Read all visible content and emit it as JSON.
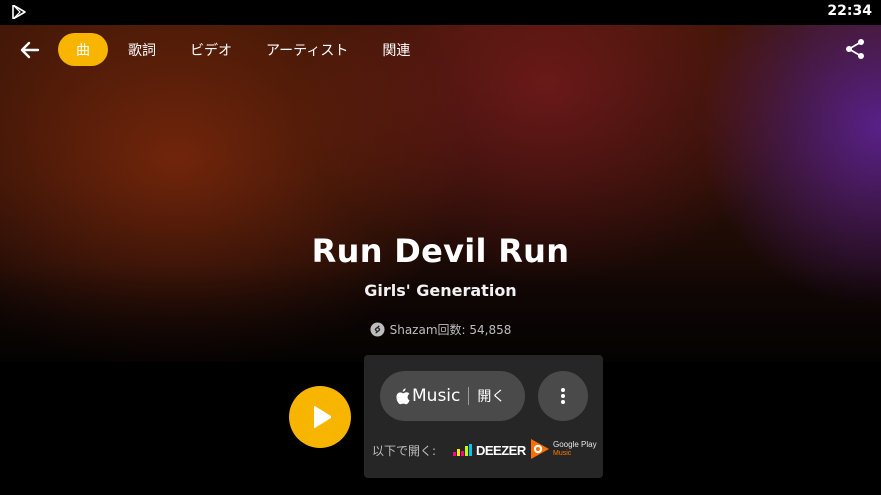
{
  "statusbar": {
    "time": "22:34",
    "app_icon": "play-store-icon"
  },
  "nav": {
    "back_icon": "arrow-left-icon",
    "share_icon": "share-icon",
    "tabs": [
      {
        "label": "曲",
        "active": true
      },
      {
        "label": "歌詞",
        "active": false
      },
      {
        "label": "ビデオ",
        "active": false
      },
      {
        "label": "アーティスト",
        "active": false
      },
      {
        "label": "関連",
        "active": false
      }
    ]
  },
  "track": {
    "title": "Run Devil Run",
    "artist": "Girls' Generation",
    "shazam_count": "Shazam回数: 54,858"
  },
  "actions": {
    "apple_music_label": "Music",
    "apple_open_label": "開く",
    "open_with_label": "以下で開く:",
    "deezer_label": "DEEZER",
    "gplay_line1": "Google Play",
    "gplay_line2": "Music"
  },
  "colors": {
    "accent": "#f7b500",
    "panel": "#262626",
    "button": "#4a4a4a"
  }
}
